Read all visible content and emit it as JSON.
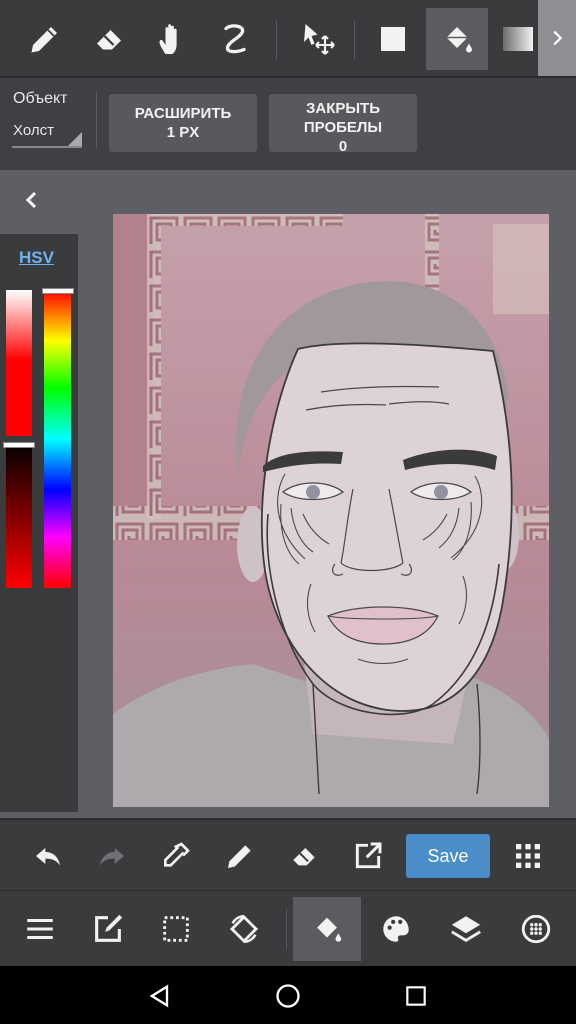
{
  "options": {
    "target_label": "Объект",
    "target_value": "Холст",
    "expand_button": [
      "РАСШИРИТЬ",
      "1 PX"
    ],
    "close_gaps_button": [
      "ЗАКРЫТЬ",
      "ПРОБЕЛЫ",
      "0"
    ]
  },
  "color_panel": {
    "mode_tab": "HSV",
    "saturation_level": 0.52,
    "hue_level": 0.0,
    "current_color": "#ff0000"
  },
  "toolbar": {
    "tools": [
      "pen-icon",
      "eraser-icon",
      "hand-icon",
      "lasso-icon",
      "move-icon",
      "fill-rectangle-icon",
      "bucket-icon",
      "gradient-icon"
    ],
    "active_tool": "bucket-icon"
  },
  "action_bar": {
    "save_label": "Save"
  },
  "menu_bar": {
    "items": [
      "menu-icon",
      "edit-icon",
      "selection-icon",
      "rotate-icon",
      "bucket-icon",
      "palette-icon",
      "layers-icon",
      "brush-icon"
    ],
    "active_item": "bucket-icon"
  },
  "colors": {
    "accent": "#4a8dc8",
    "toolbar_bg": "#3a3b3d",
    "canvas_bg": "#5d5f64"
  }
}
